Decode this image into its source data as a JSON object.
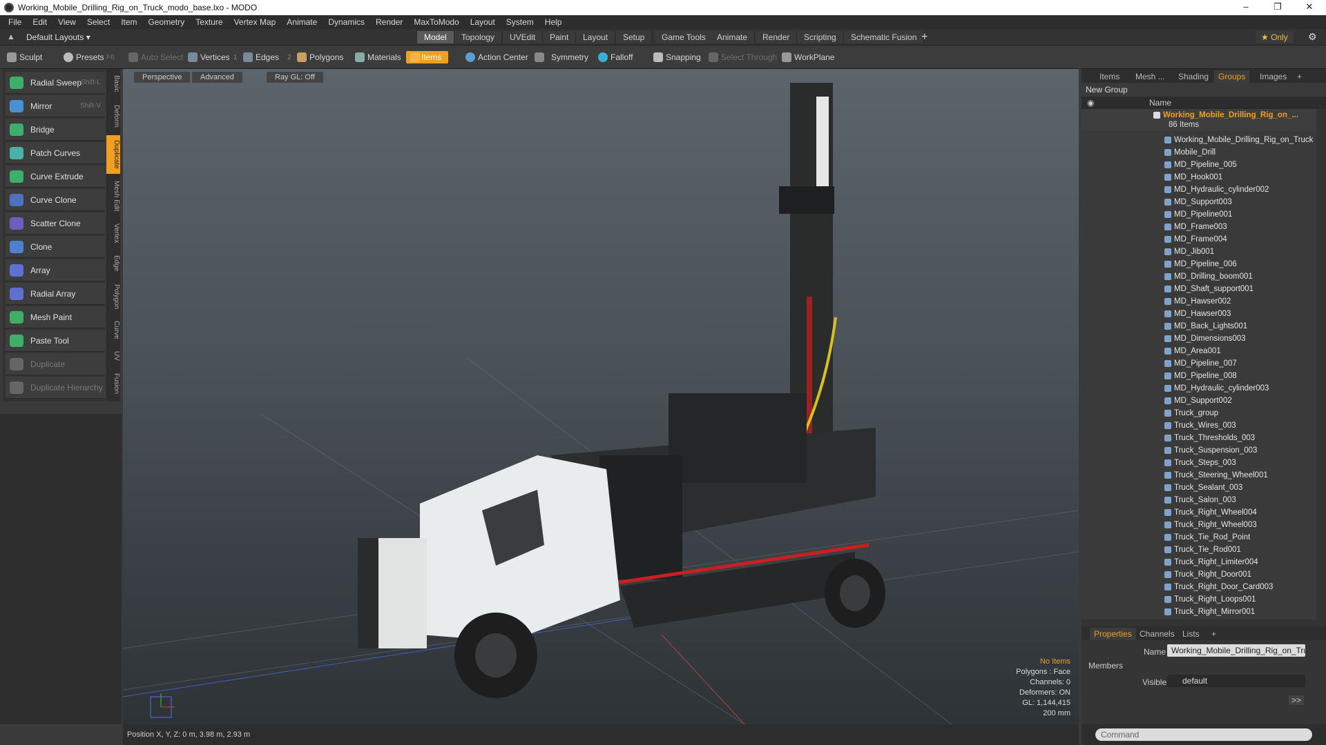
{
  "window": {
    "title": "Working_Mobile_Drilling_Rig_on_Truck_modo_base.lxo - MODO",
    "min": "–",
    "max": "❐",
    "close": "✕"
  },
  "menu": [
    "File",
    "Edit",
    "View",
    "Select",
    "Item",
    "Geometry",
    "Texture",
    "Vertex Map",
    "Animate",
    "Dynamics",
    "Render",
    "MaxToModo",
    "Layout",
    "System",
    "Help"
  ],
  "layouts": {
    "current": "Default Layouts ▾",
    "tabs": [
      "Model",
      "Topology",
      "UVEdit",
      "Paint",
      "Layout",
      "Setup",
      "Game Tools",
      "Animate",
      "Render",
      "Scripting",
      "Schematic Fusion"
    ],
    "active": "Model",
    "plus": "+",
    "only": "★ Only",
    "gear": "⚙"
  },
  "toolbar": {
    "sculpt": "Sculpt",
    "presets": "Presets",
    "presets_key": "F6",
    "auto_select": "Auto Select",
    "vertices": "Vertices",
    "vertices_count": "1",
    "edges": "Edges",
    "edges_count": "2",
    "polygons": "Polygons",
    "materials": "Materials",
    "items": "Items",
    "action_center": "Action Center",
    "symmetry": "Symmetry",
    "falloff": "Falloff",
    "snapping": "Snapping",
    "select_through": "Select Through",
    "workplane": "WorkPlane"
  },
  "tools": [
    {
      "label": "Radial Sweep",
      "shortcut": "Shift-L",
      "color": "#3fae6a"
    },
    {
      "label": "Mirror",
      "shortcut": "Shift-V",
      "color": "#4a8fd0"
    },
    {
      "label": "Bridge",
      "shortcut": "",
      "color": "#3fae6a"
    },
    {
      "label": "Patch Curves",
      "shortcut": "",
      "color": "#4ab0a8"
    },
    {
      "label": "Curve Extrude",
      "shortcut": "",
      "color": "#3fae6a"
    },
    {
      "label": "Curve Clone",
      "shortcut": "",
      "color": "#5070c0"
    },
    {
      "label": "Scatter Clone",
      "shortcut": "",
      "color": "#6a60c0"
    },
    {
      "label": "Clone",
      "shortcut": "",
      "color": "#5080d0"
    },
    {
      "label": "Array",
      "shortcut": "",
      "color": "#6070d0"
    },
    {
      "label": "Radial Array",
      "shortcut": "",
      "color": "#6070d0"
    },
    {
      "label": "Mesh Paint",
      "shortcut": "",
      "color": "#3fae6a"
    },
    {
      "label": "Paste Tool",
      "shortcut": "",
      "color": "#3fae6a"
    },
    {
      "label": "Duplicate",
      "shortcut": "",
      "color": "#666666"
    },
    {
      "label": "Duplicate Hierarchy",
      "shortcut": "",
      "color": "#666666"
    }
  ],
  "vtabs": [
    "Basic",
    "Deform",
    "Duplicate",
    "Mesh Edit",
    "Vertex",
    "Edge",
    "Polygon",
    "Curve",
    "UV",
    "Fusion"
  ],
  "viewport": {
    "perspective": "Perspective",
    "advanced": "Advanced",
    "raygl": "Ray GL: Off",
    "info": {
      "no_items": "No Items",
      "polygons": "Polygons : Face",
      "channels": "Channels: 0",
      "deformers": "Deformers: ON",
      "gl": "GL: 1,144,415",
      "scale": "200 mm"
    }
  },
  "status": {
    "position": "Position X, Y, Z:   0 m, 3.98 m, 2.93 m"
  },
  "right_tabs": [
    "Items",
    "Mesh ...",
    "Shading",
    "Groups",
    "Images",
    "+"
  ],
  "right_active": "Groups",
  "new_group": "New Group",
  "list_header": "Name",
  "group": {
    "name": "Working_Mobile_Drilling_Rig_on_...",
    "count": "86 Items"
  },
  "items": [
    "Working_Mobile_Drilling_Rig_on_Truck",
    "Mobile_Drill",
    "MD_Pipeline_005",
    "MD_Hook001",
    "MD_Hydraulic_cylinder002",
    "MD_Support003",
    "MD_Pipeline001",
    "MD_Frame003",
    "MD_Frame004",
    "MD_Jib001",
    "MD_Pipeline_006",
    "MD_Drilling_boom001",
    "MD_Shaft_support001",
    "MD_Hawser002",
    "MD_Hawser003",
    "MD_Back_Lights001",
    "MD_Dimensions003",
    "MD_Area001",
    "MD_Pipeline_007",
    "MD_Pipeline_008",
    "MD_Hydraulic_cylinder003",
    "MD_Support002",
    "Truck_group",
    "Truck_Wires_003",
    "Truck_Thresholds_003",
    "Truck_Suspension_003",
    "Truck_Steps_003",
    "Truck_Steering_Wheel001",
    "Truck_Sealant_003",
    "Truck_Salon_003",
    "Truck_Right_Wheel004",
    "Truck_Right_Wheel003",
    "Truck_Tie_Rod_Point",
    "Truck_Tie_Rod001",
    "Truck_Right_Limiter004",
    "Truck_Right_Door001",
    "Truck_Right_Door_Card003",
    "Truck_Right_Loops001",
    "Truck_Right_Mirror001"
  ],
  "props": {
    "tabs": [
      "Properties",
      "Channels",
      "Lists",
      "+"
    ],
    "name_label": "Name",
    "name_value": "Working_Mobile_Drilling_Rig_on_Truck (",
    "members": "Members",
    "visible_label": "Visible",
    "visible_value": "default",
    "arrow": ">>"
  },
  "command": {
    "placeholder": "Command"
  }
}
